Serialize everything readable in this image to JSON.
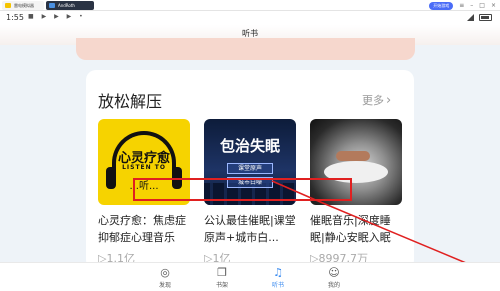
{
  "window": {
    "tabs": [
      {
        "label": "雷电模拟器"
      },
      {
        "label": "AndRoth"
      }
    ],
    "pill_label": "开始游戏"
  },
  "status_bar": {
    "time": "1:55",
    "icons": "■ ▶ ▶ ▶ •"
  },
  "header": {
    "title": "听书"
  },
  "section": {
    "title": "放松解压",
    "more_label": "更多",
    "more_icon": "chevron-right-icon"
  },
  "items": [
    {
      "cover_text_1": "心灵疗愈",
      "cover_text_2": "LISTEN TO",
      "cover_text_3": "...听...",
      "title": "心灵疗愈：焦虑症抑郁症心理音乐",
      "count": "▷1.1亿"
    },
    {
      "cover_text_1": "包治失眠",
      "cover_text_2": "课堂原声",
      "cover_text_3": "城市白噪",
      "title": "公认最佳催眠|课堂原声+城市白...",
      "count": "▷1亿"
    },
    {
      "title": "催眠音乐|深度睡眠|静心安眠入眠",
      "count": "▷8997.7万"
    }
  ],
  "bottom_nav": [
    {
      "label": "发现",
      "icon": "compass-icon"
    },
    {
      "label": "书架",
      "icon": "bookshelf-icon"
    },
    {
      "label": "听书",
      "icon": "headphones-icon",
      "active": true
    },
    {
      "label": "我的",
      "icon": "user-icon"
    }
  ],
  "colors": {
    "accent": "#3c8cf0",
    "annotation": "#e02020",
    "cover_yellow": "#f6d300"
  }
}
